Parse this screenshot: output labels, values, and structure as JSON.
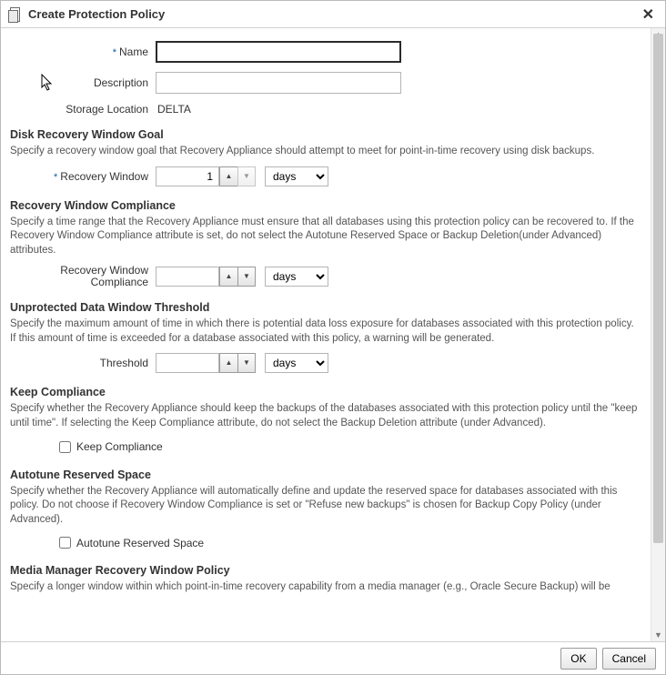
{
  "dialog": {
    "title": "Create Protection Policy",
    "ok": "OK",
    "cancel": "Cancel"
  },
  "header": {
    "name_label": "Name",
    "name_value": "",
    "desc_label": "Description",
    "desc_value": "",
    "storage_label": "Storage Location",
    "storage_value": "DELTA"
  },
  "disk_recovery": {
    "heading": "Disk Recovery Window Goal",
    "help": "Specify a recovery window goal that Recovery Appliance should attempt to meet for point-in-time recovery using disk backups.",
    "label": "Recovery Window",
    "value": "1",
    "unit": "days"
  },
  "rw_compliance": {
    "heading": "Recovery Window Compliance",
    "help": "Specify a time range that the Recovery Appliance must ensure that all databases using this protection policy can be recovered to. If the Recovery Window Compliance attribute is set, do not select the Autotune Reserved Space or Backup Deletion(under Advanced) attributes.",
    "label": "Recovery Window Compliance",
    "value": "",
    "unit": "days"
  },
  "unprotected": {
    "heading": "Unprotected Data Window Threshold",
    "help": "Specify the maximum amount of time in which there is potential data loss exposure for databases associated with this protection policy. If this amount of time is exceeded for a database associated with this policy, a warning will be generated.",
    "label": "Threshold",
    "value": "",
    "unit": "days"
  },
  "keep_compliance": {
    "heading": "Keep Compliance",
    "help": "Specify whether the Recovery Appliance should keep the backups of the databases associated with this protection policy until the \"keep until time\". If selecting the Keep Compliance attribute, do not select the Backup Deletion attribute (under Advanced).",
    "checkbox_label": "Keep Compliance"
  },
  "autotune": {
    "heading": "Autotune Reserved Space",
    "help": "Specify whether the Recovery Appliance will automatically define and update the reserved space for databases associated with this policy. Do not choose if Recovery Window Compliance is set or \"Refuse new backups\" is chosen for Backup Copy Policy (under Advanced).",
    "checkbox_label": "Autotune Reserved Space"
  },
  "media_mgr": {
    "heading": "Media Manager Recovery Window Policy",
    "help": "Specify a longer window within which point-in-time recovery capability from a media manager (e.g., Oracle Secure Backup) will be"
  },
  "unit_options": [
    "days"
  ]
}
